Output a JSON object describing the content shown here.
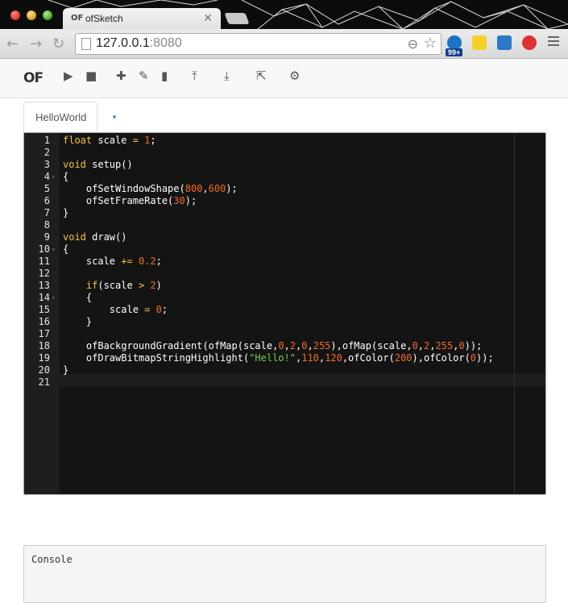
{
  "browser": {
    "tab_title": "ofSketch",
    "tab_favicon": "OF",
    "tab_close": "✕",
    "url_host": "127.0.0.1",
    "url_port": ":8080",
    "extension_badge": "99+"
  },
  "app": {
    "logo": "OF",
    "toolbar": [
      {
        "name": "play-icon",
        "glyph": "▶"
      },
      {
        "name": "stop-icon",
        "glyph": "■"
      },
      {
        "name": "add-icon",
        "glyph": "✚"
      },
      {
        "name": "attach-icon",
        "glyph": "✎"
      },
      {
        "name": "file-icon",
        "glyph": "▮"
      },
      {
        "name": "upload-icon",
        "glyph": "⤒"
      },
      {
        "name": "download-icon",
        "glyph": "⤓"
      },
      {
        "name": "export-icon",
        "glyph": "⇱"
      },
      {
        "name": "settings-icon",
        "glyph": "⚙"
      }
    ],
    "tab_label": "HelloWorld",
    "tab_dropdown": "▼"
  },
  "editor": {
    "active_line": 21,
    "lines": [
      {
        "n": "1",
        "fold": "",
        "tokens": [
          {
            "t": "float",
            "c": "kw"
          },
          {
            "t": " scale "
          },
          {
            "t": "=",
            "c": "kw"
          },
          {
            "t": " "
          },
          {
            "t": "1",
            "c": "num"
          },
          {
            "t": ";"
          }
        ]
      },
      {
        "n": "2",
        "fold": "",
        "tokens": []
      },
      {
        "n": "3",
        "fold": "",
        "tokens": [
          {
            "t": "void",
            "c": "kw"
          },
          {
            "t": " setup()"
          }
        ]
      },
      {
        "n": "4",
        "fold": "▾",
        "tokens": [
          {
            "t": "{"
          }
        ]
      },
      {
        "n": "5",
        "fold": "",
        "tokens": [
          {
            "t": "    ofSetWindowShape("
          },
          {
            "t": "800",
            "c": "num"
          },
          {
            "t": ","
          },
          {
            "t": "600",
            "c": "num"
          },
          {
            "t": ");"
          }
        ]
      },
      {
        "n": "6",
        "fold": "",
        "tokens": [
          {
            "t": "    ofSetFrameRate("
          },
          {
            "t": "30",
            "c": "num"
          },
          {
            "t": ");"
          }
        ]
      },
      {
        "n": "7",
        "fold": "",
        "tokens": [
          {
            "t": "}"
          }
        ]
      },
      {
        "n": "8",
        "fold": "",
        "tokens": []
      },
      {
        "n": "9",
        "fold": "",
        "tokens": [
          {
            "t": "void",
            "c": "kw"
          },
          {
            "t": " draw()"
          }
        ]
      },
      {
        "n": "10",
        "fold": "▾",
        "tokens": [
          {
            "t": "{"
          }
        ]
      },
      {
        "n": "11",
        "fold": "",
        "tokens": [
          {
            "t": "    scale "
          },
          {
            "t": "+=",
            "c": "kw"
          },
          {
            "t": " "
          },
          {
            "t": "0.2",
            "c": "num"
          },
          {
            "t": ";"
          }
        ]
      },
      {
        "n": "12",
        "fold": "",
        "tokens": []
      },
      {
        "n": "13",
        "fold": "",
        "tokens": [
          {
            "t": "    "
          },
          {
            "t": "if",
            "c": "kw"
          },
          {
            "t": "(scale "
          },
          {
            "t": ">",
            "c": "kw"
          },
          {
            "t": " "
          },
          {
            "t": "2",
            "c": "num"
          },
          {
            "t": ")"
          }
        ]
      },
      {
        "n": "14",
        "fold": "▾",
        "tokens": [
          {
            "t": "    {"
          }
        ]
      },
      {
        "n": "15",
        "fold": "",
        "tokens": [
          {
            "t": "        scale "
          },
          {
            "t": "=",
            "c": "kw"
          },
          {
            "t": " "
          },
          {
            "t": "0",
            "c": "num"
          },
          {
            "t": ";"
          }
        ]
      },
      {
        "n": "16",
        "fold": "",
        "tokens": [
          {
            "t": "    }"
          }
        ]
      },
      {
        "n": "17",
        "fold": "",
        "tokens": []
      },
      {
        "n": "18",
        "fold": "",
        "tokens": [
          {
            "t": "    ofBackgroundGradient(ofMap(scale,"
          },
          {
            "t": "0",
            "c": "num"
          },
          {
            "t": ","
          },
          {
            "t": "2",
            "c": "num"
          },
          {
            "t": ","
          },
          {
            "t": "0",
            "c": "num"
          },
          {
            "t": ","
          },
          {
            "t": "255",
            "c": "num"
          },
          {
            "t": "),ofMap(scale,"
          },
          {
            "t": "0",
            "c": "num"
          },
          {
            "t": ","
          },
          {
            "t": "2",
            "c": "num"
          },
          {
            "t": ","
          },
          {
            "t": "255",
            "c": "num"
          },
          {
            "t": ","
          },
          {
            "t": "0",
            "c": "num"
          },
          {
            "t": "));"
          }
        ]
      },
      {
        "n": "19",
        "fold": "",
        "tokens": [
          {
            "t": "    ofDrawBitmapStringHighlight("
          },
          {
            "t": "\"Hello!\"",
            "c": "str"
          },
          {
            "t": ","
          },
          {
            "t": "110",
            "c": "num"
          },
          {
            "t": ","
          },
          {
            "t": "120",
            "c": "num"
          },
          {
            "t": ",ofColor("
          },
          {
            "t": "200",
            "c": "num"
          },
          {
            "t": "),ofColor("
          },
          {
            "t": "0",
            "c": "num"
          },
          {
            "t": "));"
          }
        ]
      },
      {
        "n": "20",
        "fold": "",
        "tokens": [
          {
            "t": "}"
          }
        ]
      },
      {
        "n": "21",
        "fold": "",
        "tokens": []
      }
    ]
  },
  "console": {
    "label": "Console"
  },
  "colors": {
    "keyword": "#f7c23a",
    "number": "#f26b23",
    "string": "#7ec95a",
    "editor_bg": "#141414",
    "accent": "#3b86c6"
  }
}
